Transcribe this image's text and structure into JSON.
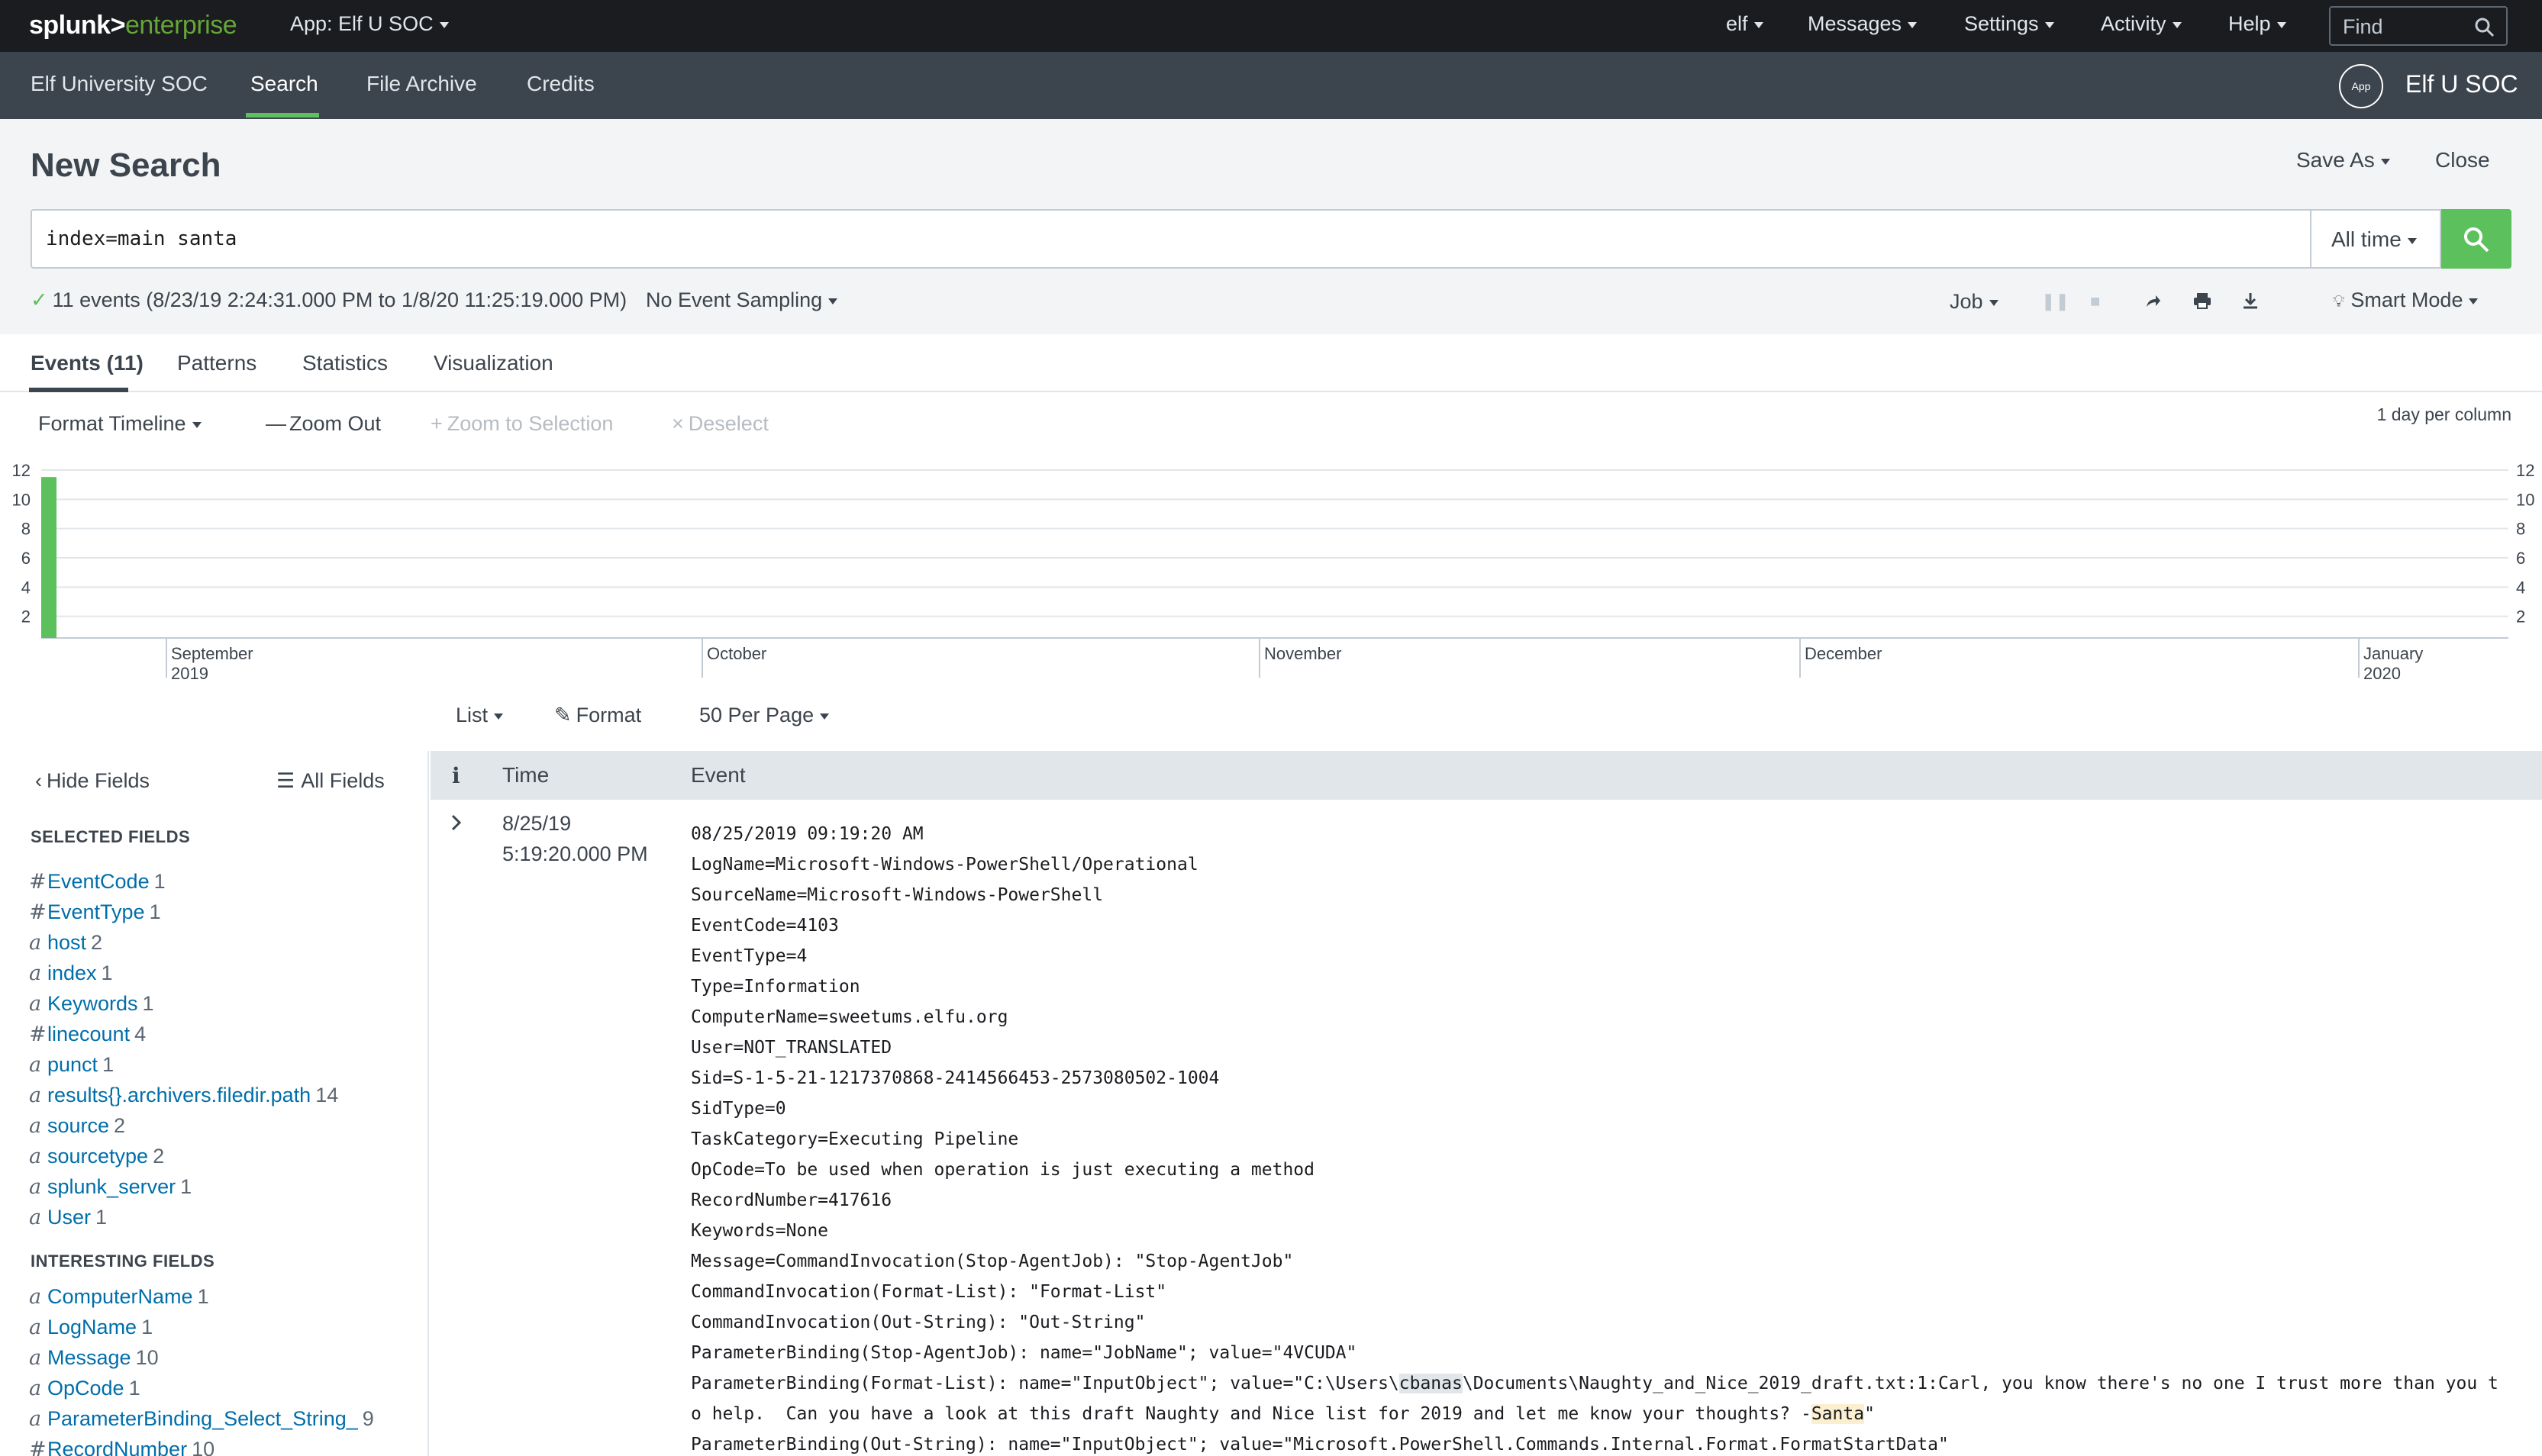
{
  "topbar": {
    "logo_splunk": "splunk>",
    "logo_enterprise": "enterprise",
    "app_menu": "App: Elf U SOC",
    "user_menu": "elf",
    "messages": "Messages",
    "settings": "Settings",
    "activity": "Activity",
    "help": "Help",
    "find_placeholder": "Find"
  },
  "appbar": {
    "nav": [
      "Elf University SOC",
      "Search",
      "File Archive",
      "Credits"
    ],
    "active_nav": "Search",
    "app_badge": "App",
    "app_name": "Elf U SOC"
  },
  "search": {
    "title": "New Search",
    "save_as": "Save As",
    "close": "Close",
    "query": "index=main santa",
    "time_range": "All time",
    "status": "11 events (8/23/19 2:24:31.000 PM to 1/8/20 11:25:19.000 PM)",
    "sampling": "No Event Sampling",
    "job": "Job",
    "mode": "Smart Mode"
  },
  "tabs": [
    "Events (11)",
    "Patterns",
    "Statistics",
    "Visualization"
  ],
  "timeline": {
    "format": "Format Timeline",
    "zoom_out": "Zoom Out",
    "zoom_selection": "Zoom to Selection",
    "deselect": "Deselect",
    "scale": "1 day per column",
    "y_ticks": [
      "12",
      "10",
      "8",
      "6",
      "4",
      "2"
    ],
    "months": [
      {
        "label": "September",
        "year": "2019"
      },
      {
        "label": "October",
        "year": ""
      },
      {
        "label": "November",
        "year": ""
      },
      {
        "label": "December",
        "year": ""
      },
      {
        "label": "January",
        "year": "2020"
      }
    ]
  },
  "chart_data": {
    "type": "bar",
    "categories": [
      "8/25/19"
    ],
    "values": [
      11
    ],
    "ylim": [
      0,
      12
    ],
    "yticks": [
      2,
      4,
      6,
      8,
      10,
      12
    ],
    "grid": true,
    "colors": {
      "bar": "#5cc05c"
    }
  },
  "results_controls": {
    "list": "List",
    "format": "Format",
    "per_page": "50 Per Page"
  },
  "sidebar": {
    "hide_fields": "Hide Fields",
    "all_fields": "All Fields",
    "selected_heading": "SELECTED FIELDS",
    "selected": [
      {
        "type": "#",
        "name": "EventCode",
        "count": "1"
      },
      {
        "type": "#",
        "name": "EventType",
        "count": "1"
      },
      {
        "type": "a",
        "name": "host",
        "count": "2"
      },
      {
        "type": "a",
        "name": "index",
        "count": "1"
      },
      {
        "type": "a",
        "name": "Keywords",
        "count": "1"
      },
      {
        "type": "#",
        "name": "linecount",
        "count": "4"
      },
      {
        "type": "a",
        "name": "punct",
        "count": "1"
      },
      {
        "type": "a",
        "name": "results{}.archivers.filedir.path",
        "count": "14"
      },
      {
        "type": "a",
        "name": "source",
        "count": "2"
      },
      {
        "type": "a",
        "name": "sourcetype",
        "count": "2"
      },
      {
        "type": "a",
        "name": "splunk_server",
        "count": "1"
      },
      {
        "type": "a",
        "name": "User",
        "count": "1"
      }
    ],
    "interesting_heading": "INTERESTING FIELDS",
    "interesting": [
      {
        "type": "a",
        "name": "ComputerName",
        "count": "1"
      },
      {
        "type": "a",
        "name": "LogName",
        "count": "1"
      },
      {
        "type": "a",
        "name": "Message",
        "count": "10"
      },
      {
        "type": "a",
        "name": "OpCode",
        "count": "1"
      },
      {
        "type": "a",
        "name": "ParameterBinding_Select_String_",
        "count": "9"
      },
      {
        "type": "#",
        "name": "RecordNumber",
        "count": "10"
      }
    ]
  },
  "events": {
    "col_info": "i",
    "col_time": "Time",
    "col_event": "Event",
    "rows": [
      {
        "time_date": "8/25/19",
        "time_clock": "5:19:20.000 PM",
        "lines": [
          "08/25/2019 09:19:20 AM",
          "LogName=Microsoft-Windows-PowerShell/Operational",
          "SourceName=Microsoft-Windows-PowerShell",
          "EventCode=4103",
          "EventType=4",
          "Type=Information",
          "ComputerName=sweetums.elfu.org",
          "User=NOT_TRANSLATED",
          "Sid=S-1-5-21-1217370868-2414566453-2573080502-1004",
          "SidType=0",
          "TaskCategory=Executing Pipeline",
          "OpCode=To be used when operation is just executing a method",
          "RecordNumber=417616",
          "Keywords=None",
          "Message=CommandInvocation(Stop-AgentJob): \"Stop-AgentJob\"",
          "CommandInvocation(Format-List): \"Format-List\"",
          "CommandInvocation(Out-String): \"Out-String\"",
          "ParameterBinding(Stop-AgentJob): name=\"JobName\"; value=\"4VCUDA\"",
          "ParameterBinding(Format-List): name=\"InputObject\"; value=\"C:\\Users\\cbanas\\Documents\\Naughty_and_Nice_2019_draft.txt:1:Carl, you know there's no one I trust more than you t",
          "o help.  Can you have a look at this draft Naughty and Nice list for 2019 and let me know your thoughts? -Santa\"",
          "ParameterBinding(Out-String): name=\"InputObject\"; value=\"Microsoft.PowerShell.Commands.Internal.Format.FormatStartData\""
        ]
      }
    ]
  }
}
